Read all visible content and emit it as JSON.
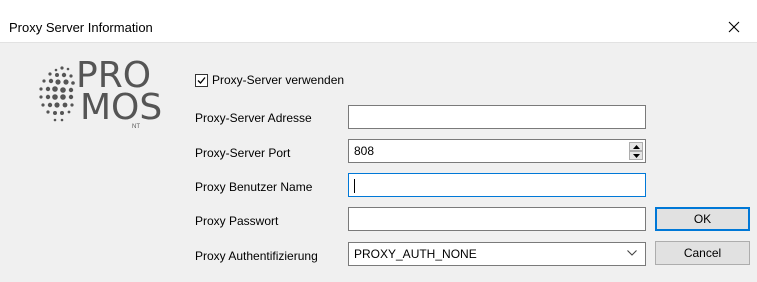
{
  "window": {
    "title": "Proxy Server Information"
  },
  "logo": {
    "text_top": "PRO",
    "text_bottom": "MOS",
    "suffix": "NT"
  },
  "form": {
    "use_proxy": {
      "label": "Proxy-Server verwenden",
      "checked": true
    },
    "address": {
      "label": "Proxy-Server Adresse",
      "value": ""
    },
    "port": {
      "label": "Proxy-Server Port",
      "value": "808"
    },
    "username": {
      "label": "Proxy Benutzer Name",
      "value": ""
    },
    "password": {
      "label": "Proxy Passwort",
      "value": ""
    },
    "auth": {
      "label": "Proxy Authentifizierung",
      "selected": "PROXY_AUTH_NONE"
    }
  },
  "buttons": {
    "ok": "OK",
    "cancel": "Cancel"
  },
  "colors": {
    "focus": "#0078d7",
    "dialog_bg": "#f0f0f0",
    "logo": "#555555"
  }
}
